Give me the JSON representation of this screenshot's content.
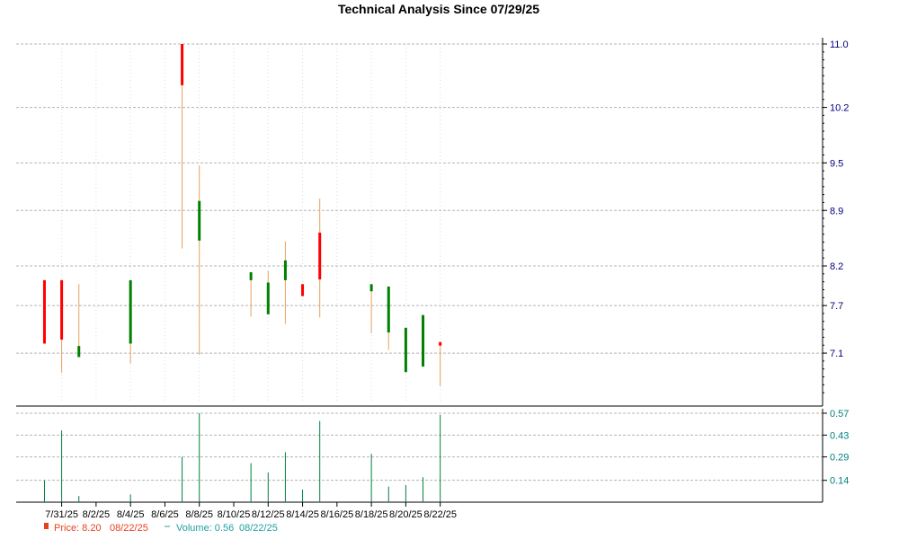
{
  "chart_data": [
    {
      "type": "candlestick",
      "title": "Technical Analysis Since 07/29/25",
      "ylim": [
        6.5,
        11.0
      ],
      "y_ticks": [
        "11.0",
        "10.2",
        "9.5",
        "8.9",
        "8.2",
        "7.7",
        "7.1"
      ],
      "y_tick_values": [
        11.0,
        10.2,
        9.5,
        8.9,
        8.2,
        7.7,
        7.1
      ],
      "x_ticks": [
        "7/31/25",
        "8/2/25",
        "8/4/25",
        "8/6/25",
        "8/8/25",
        "8/10/25",
        "8/12/25",
        "8/14/25",
        "8/16/25",
        "8/18/25",
        "8/20/25",
        "8/22/25"
      ],
      "grid": true,
      "candles": [
        {
          "date": "7/30/25",
          "open": 8.02,
          "high": 8.02,
          "low": 7.22,
          "close": 7.22,
          "dir": "down"
        },
        {
          "date": "7/31/25",
          "open": 8.02,
          "high": 8.02,
          "low": 6.85,
          "close": 7.27,
          "dir": "down"
        },
        {
          "date": "8/1/25",
          "open": 7.05,
          "high": 7.97,
          "low": 7.05,
          "close": 7.19,
          "dir": "up"
        },
        {
          "date": "8/4/25",
          "open": 7.22,
          "high": 8.02,
          "low": 6.97,
          "close": 8.02,
          "dir": "up"
        },
        {
          "date": "8/7/25",
          "open": 11.0,
          "high": 11.0,
          "low": 8.42,
          "close": 10.48,
          "dir": "down"
        },
        {
          "date": "8/8/25",
          "open": 8.52,
          "high": 9.47,
          "low": 7.08,
          "close": 9.02,
          "dir": "up"
        },
        {
          "date": "8/11/25",
          "open": 8.02,
          "high": 8.12,
          "low": 7.56,
          "close": 8.12,
          "dir": "up"
        },
        {
          "date": "8/12/25",
          "open": 7.59,
          "high": 8.14,
          "low": 7.59,
          "close": 7.99,
          "dir": "up"
        },
        {
          "date": "8/13/25",
          "open": 8.02,
          "high": 8.51,
          "low": 7.47,
          "close": 8.27,
          "dir": "up"
        },
        {
          "date": "8/14/25",
          "open": 7.97,
          "high": 7.97,
          "low": 7.82,
          "close": 7.82,
          "dir": "down"
        },
        {
          "date": "8/15/25",
          "open": 8.62,
          "high": 9.05,
          "low": 7.55,
          "close": 8.03,
          "dir": "down"
        },
        {
          "date": "8/18/25",
          "open": 7.88,
          "high": 7.97,
          "low": 7.35,
          "close": 7.97,
          "dir": "up"
        },
        {
          "date": "8/19/25",
          "open": 7.36,
          "high": 7.94,
          "low": 7.14,
          "close": 7.94,
          "dir": "up"
        },
        {
          "date": "8/20/25",
          "open": 6.86,
          "high": 7.42,
          "low": 6.86,
          "close": 7.42,
          "dir": "up"
        },
        {
          "date": "8/21/25",
          "open": 6.93,
          "high": 7.58,
          "low": 6.93,
          "close": 7.58,
          "dir": "up"
        },
        {
          "date": "8/22/25",
          "open": 7.24,
          "high": 7.24,
          "low": 6.68,
          "close": 7.2,
          "dir": "down"
        }
      ]
    },
    {
      "type": "bar",
      "ylim": [
        0,
        0.57
      ],
      "y_ticks": [
        "0.57",
        "0.43",
        "0.29",
        "0.14"
      ],
      "y_tick_values": [
        0.57,
        0.43,
        0.29,
        0.14
      ],
      "grid": true,
      "volumes": [
        {
          "date": "7/30/25",
          "value": 0.14
        },
        {
          "date": "7/31/25",
          "value": 0.46
        },
        {
          "date": "8/1/25",
          "value": 0.04
        },
        {
          "date": "8/4/25",
          "value": 0.05
        },
        {
          "date": "8/7/25",
          "value": 0.29
        },
        {
          "date": "8/8/25",
          "value": 0.57
        },
        {
          "date": "8/11/25",
          "value": 0.25
        },
        {
          "date": "8/12/25",
          "value": 0.19
        },
        {
          "date": "8/13/25",
          "value": 0.32
        },
        {
          "date": "8/14/25",
          "value": 0.08
        },
        {
          "date": "8/15/25",
          "value": 0.52
        },
        {
          "date": "8/18/25",
          "value": 0.31
        },
        {
          "date": "8/19/25",
          "value": 0.1
        },
        {
          "date": "8/20/25",
          "value": 0.11
        },
        {
          "date": "8/21/25",
          "value": 0.16
        },
        {
          "date": "8/22/25",
          "value": 0.56
        }
      ]
    }
  ],
  "legend": {
    "price_label": "Price: 8.20",
    "price_date": "08/22/25",
    "volume_label": "Volume: 0.56",
    "volume_date": "08/22/25"
  },
  "colors": {
    "up": "#008000",
    "down": "#ff0000",
    "wick": "#e8a060",
    "volume": "#008040",
    "grid": "#b4b4b4",
    "price_axis_text": "#000080",
    "volume_axis_text": "#008080",
    "legend_price": "#e8401c",
    "legend_volume": "#20a0a0"
  }
}
